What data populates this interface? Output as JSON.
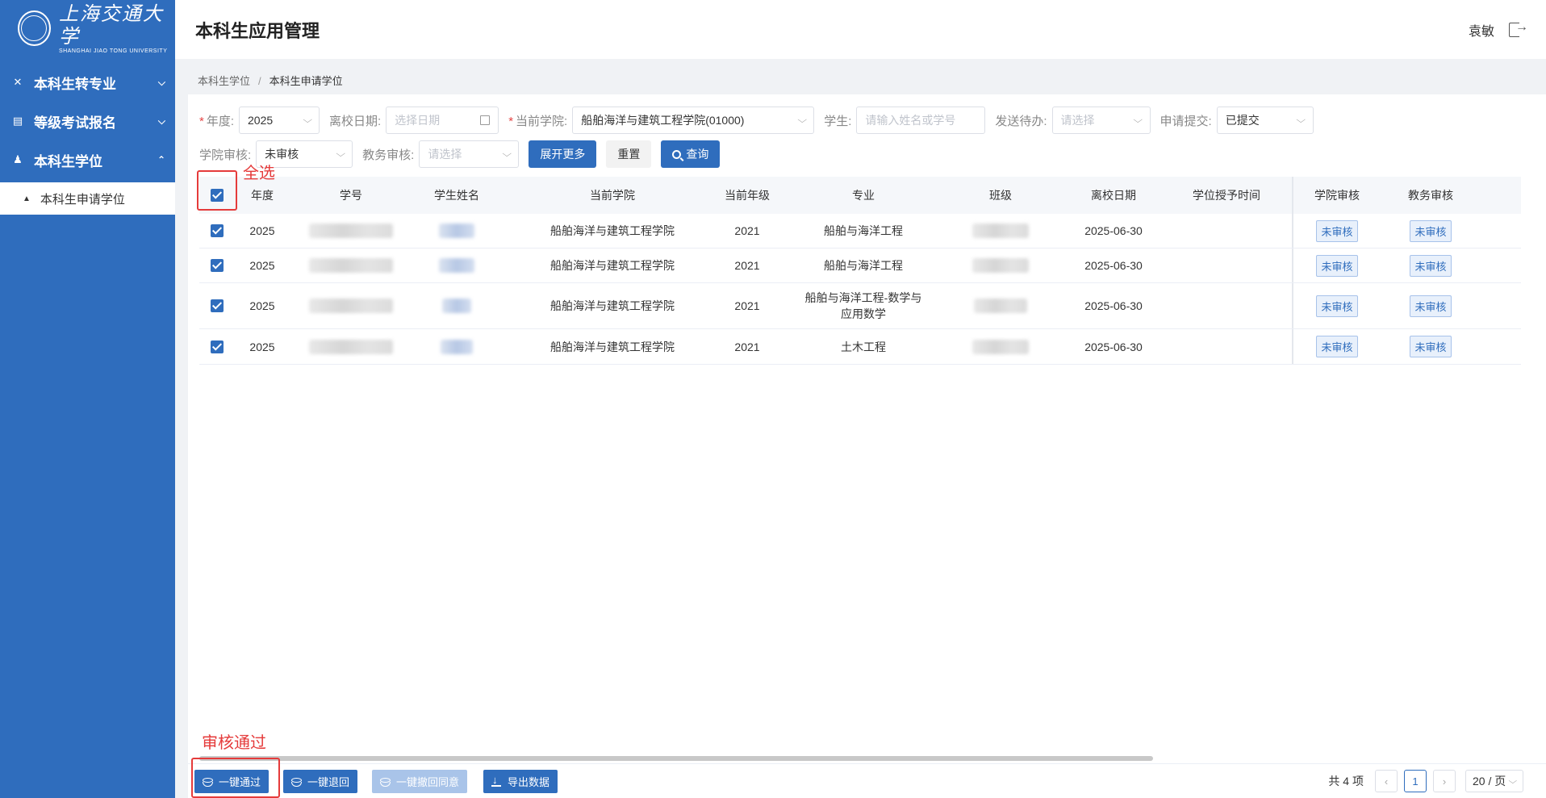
{
  "logo": {
    "seal": "交大",
    "cn": "上海交通大学",
    "en": "SHANGHAI JIAO TONG UNIVERSITY"
  },
  "sidebar": {
    "groups": [
      {
        "label": "本科生转专业",
        "icon": "swap-icon",
        "chevron": "⌵"
      },
      {
        "label": "等级考试报名",
        "icon": "list-icon",
        "chevron": "⌵"
      },
      {
        "label": "本科生学位",
        "icon": "graduate-icon",
        "chevron": "⌃"
      }
    ],
    "active_item": {
      "label": "本科生申请学位",
      "icon": "graduate-cap-icon"
    }
  },
  "header": {
    "title": "本科生应用管理",
    "user": "袁敏"
  },
  "breadcrumb": {
    "parent": "本科生学位",
    "separator": "/",
    "current": "本科生申请学位"
  },
  "filters": {
    "year": {
      "label": "年度:",
      "value": "2025"
    },
    "leave_date": {
      "label": "离校日期:",
      "placeholder": "选择日期"
    },
    "college": {
      "label": "当前学院:",
      "value": "船舶海洋与建筑工程学院(01000)"
    },
    "student": {
      "label": "学生:",
      "placeholder": "请输入姓名或学号"
    },
    "todo": {
      "label": "发送待办:",
      "placeholder": "请选择"
    },
    "submit": {
      "label": "申请提交:",
      "value": "已提交"
    },
    "college_audit": {
      "label": "学院审核:",
      "value": "未审核"
    },
    "admin_audit": {
      "label": "教务审核:",
      "placeholder": "请选择"
    },
    "buttons": {
      "expand": "展开更多",
      "reset": "重置",
      "search": "查询"
    }
  },
  "table": {
    "columns": [
      "年度",
      "学号",
      "学生姓名",
      "当前学院",
      "当前年级",
      "专业",
      "班级",
      "离校日期",
      "学位授予时间",
      "学院审核",
      "教务审核"
    ],
    "rows": [
      {
        "year": "2025",
        "college": "船舶海洋与建筑工程学院",
        "grade": "2021",
        "major": "船舶与海洋工程",
        "leave": "2025-06-30",
        "grant": "",
        "college_audit": "未审核",
        "admin_audit": "未审核"
      },
      {
        "year": "2025",
        "college": "船舶海洋与建筑工程学院",
        "grade": "2021",
        "major": "船舶与海洋工程",
        "leave": "2025-06-30",
        "grant": "",
        "college_audit": "未审核",
        "admin_audit": "未审核"
      },
      {
        "year": "2025",
        "college": "船舶海洋与建筑工程学院",
        "grade": "2021",
        "major": "船舶与海洋工程-数学与应用数学",
        "leave": "2025-06-30",
        "grant": "",
        "college_audit": "未审核",
        "admin_audit": "未审核"
      },
      {
        "year": "2025",
        "college": "船舶海洋与建筑工程学院",
        "grade": "2021",
        "major": "土木工程",
        "leave": "2025-06-30",
        "grant": "",
        "college_audit": "未审核",
        "admin_audit": "未审核"
      }
    ]
  },
  "annotations": {
    "select_all": "全选",
    "approve": "审核通过"
  },
  "footer": {
    "buttons": {
      "pass": "一键通过",
      "return": "一键退回",
      "revoke": "一键撤回同意",
      "export": "导出数据"
    },
    "total": "共 4 项",
    "prev": "‹",
    "page": "1",
    "next": "›",
    "page_size": "20 / 页"
  },
  "colors": {
    "primary": "#2f6dbd",
    "annotation": "#e53b3b"
  }
}
